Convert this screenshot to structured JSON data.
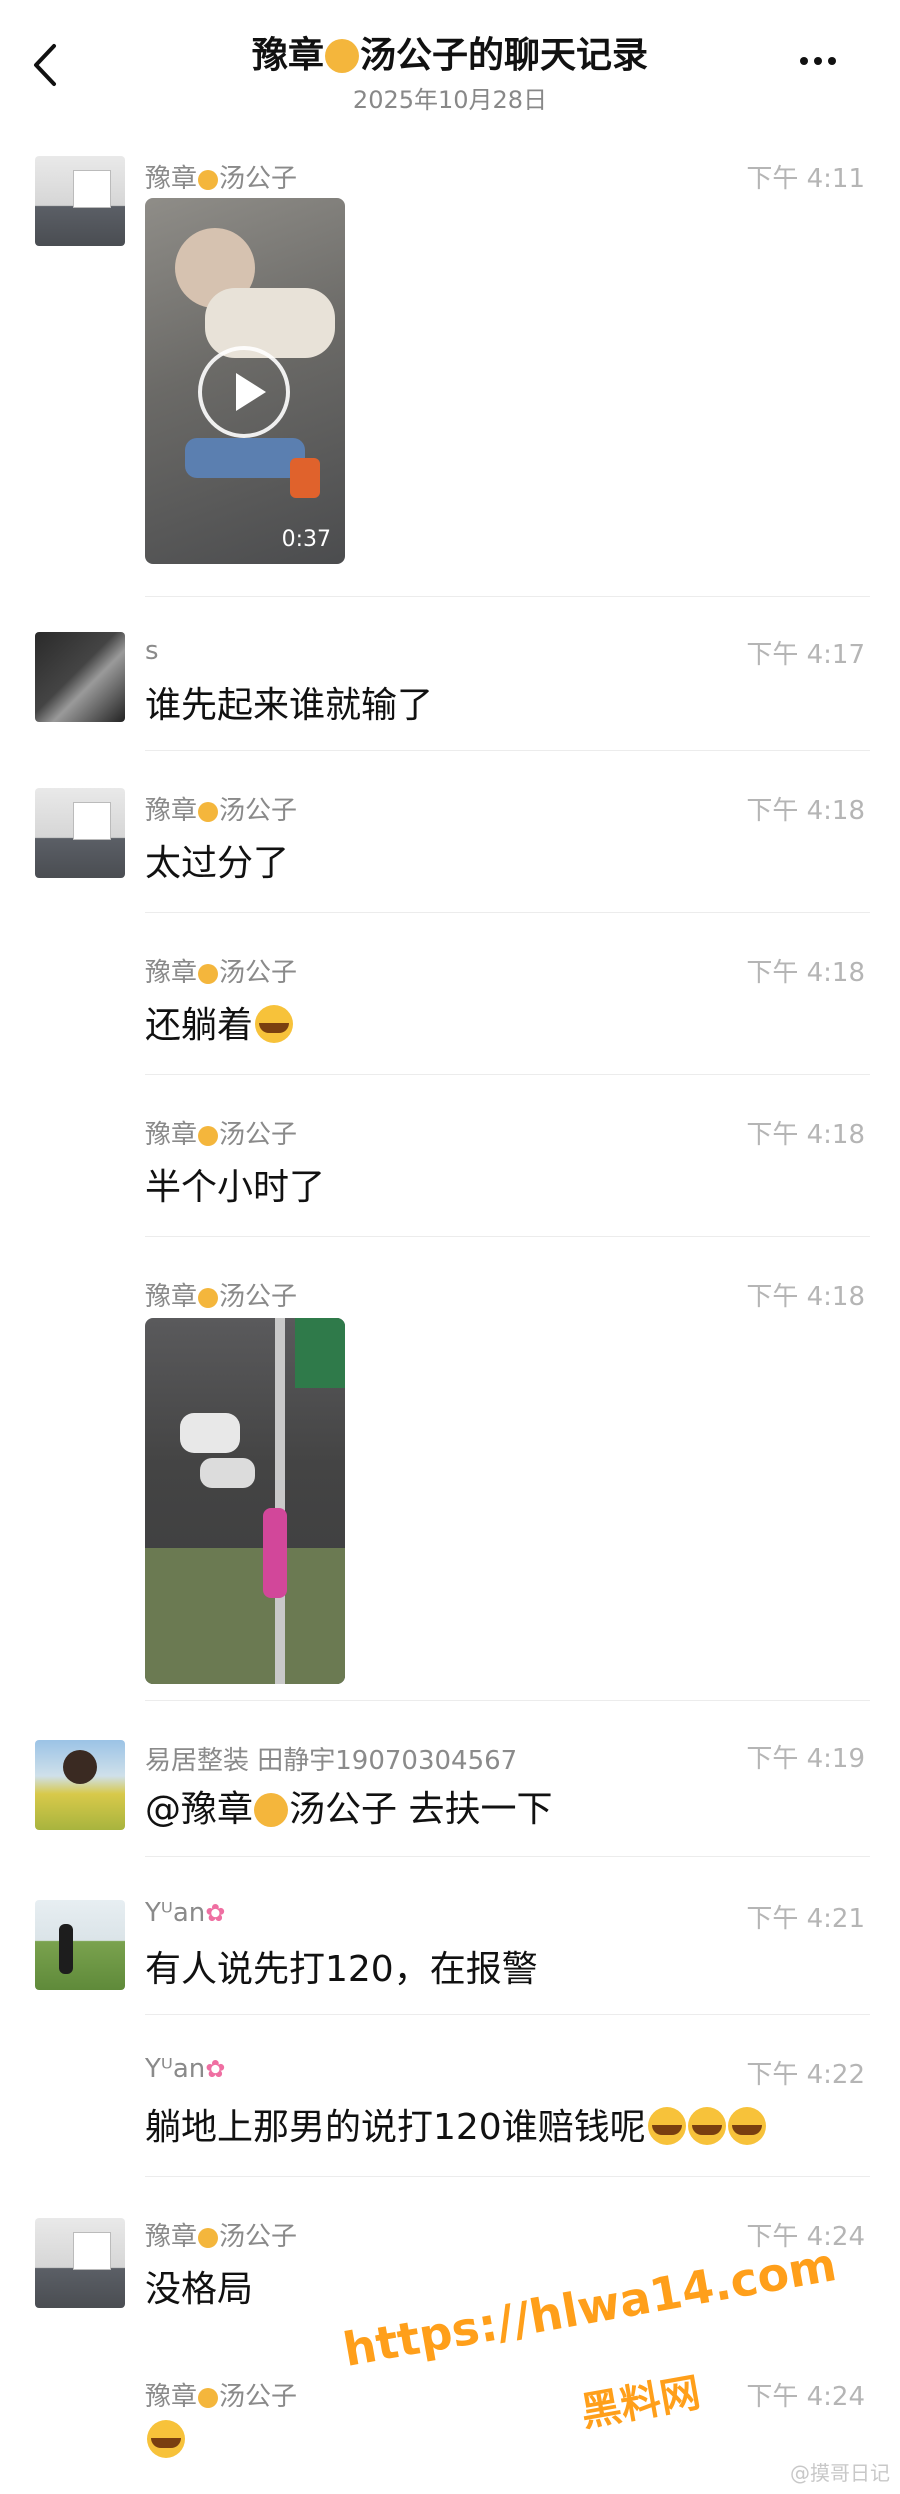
{
  "header": {
    "title": "豫章汤公子的聊天记录",
    "title_pre": "豫章",
    "title_post": "汤公子的聊天记录",
    "date": "2025年10月28日"
  },
  "messages": [
    {
      "sender_pre": "豫章",
      "sender_post": "汤公子",
      "time": "下午 4:11",
      "video_duration": "0:37"
    },
    {
      "sender": "s",
      "time": "下午 4:17",
      "text": "谁先起来谁就输了"
    },
    {
      "sender_pre": "豫章",
      "sender_post": "汤公子",
      "time": "下午 4:18",
      "text": "太过分了"
    },
    {
      "sender_pre": "豫章",
      "sender_post": "汤公子",
      "time": "下午 4:18",
      "text": "还躺着"
    },
    {
      "sender_pre": "豫章",
      "sender_post": "汤公子",
      "time": "下午 4:18",
      "text": "半个小时了"
    },
    {
      "sender_pre": "豫章",
      "sender_post": "汤公子",
      "time": "下午 4:18"
    },
    {
      "sender": "易居整装 田静宇19070304567",
      "time": "下午 4:19",
      "text_pre": "@豫章",
      "text_post": "汤公子 去扶一下"
    },
    {
      "sender": "Yᵁan",
      "time": "下午 4:21",
      "text": "有人说先打120，在报警"
    },
    {
      "sender": "Yᵁan",
      "time": "下午 4:22",
      "text": "躺地上那男的说打120谁赔钱呢"
    },
    {
      "sender_pre": "豫章",
      "sender_post": "汤公子",
      "time": "下午 4:24",
      "text": "没格局"
    },
    {
      "sender_pre": "豫章",
      "sender_post": "汤公子",
      "time": "下午 4:24"
    }
  ],
  "watermark": {
    "url": "https://hlwa14.com",
    "site": "黑料网"
  },
  "credit": "@摸哥日记"
}
